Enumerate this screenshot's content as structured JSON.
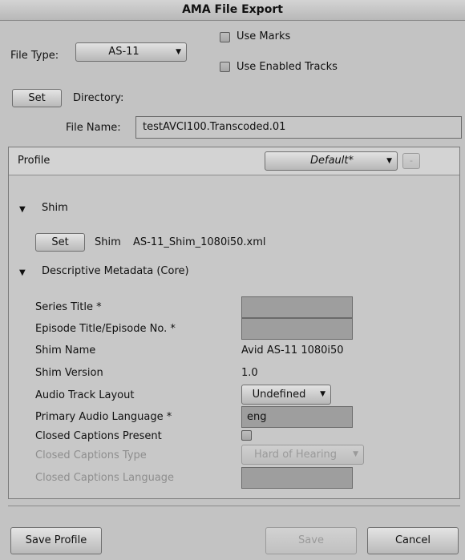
{
  "window": {
    "title": "AMA File Export"
  },
  "file_type": {
    "label": "File Type:",
    "value": "AS-11"
  },
  "options": {
    "use_marks": "Use Marks",
    "use_enabled_tracks": "Use Enabled Tracks"
  },
  "directory": {
    "set_label": "Set",
    "label": "Directory:"
  },
  "file_name": {
    "label": "File Name:",
    "value": "testAVCI100.Transcoded.01"
  },
  "profile": {
    "label": "Profile",
    "value": "Default*",
    "remove_label": "-"
  },
  "shim": {
    "section_label": "Shim",
    "set_label": "Set",
    "label": "Shim",
    "file": "AS-11_Shim_1080i50.xml"
  },
  "metadata": {
    "section_label": "Descriptive Metadata (Core)",
    "series_title": "Series Title *",
    "episode_title": "Episode Title/Episode No. *",
    "shim_name_label": "Shim Name",
    "shim_name_value": "Avid AS-11 1080i50",
    "shim_version_label": "Shim Version",
    "shim_version_value": "1.0",
    "audio_track_layout_label": "Audio Track Layout",
    "audio_track_layout_value": "Undefined",
    "primary_audio_language_label": "Primary Audio Language *",
    "primary_audio_language_value": "eng",
    "closed_captions_present_label": "Closed Captions Present",
    "closed_captions_type_label": "Closed Captions Type",
    "closed_captions_type_value": "Hard of Hearing",
    "closed_captions_language_label": "Closed Captions Language"
  },
  "footer": {
    "save_profile": "Save Profile",
    "save": "Save",
    "cancel": "Cancel"
  },
  "icons": {
    "dropdown": "chevron-down-icon",
    "expand": "triangle-down-icon"
  }
}
